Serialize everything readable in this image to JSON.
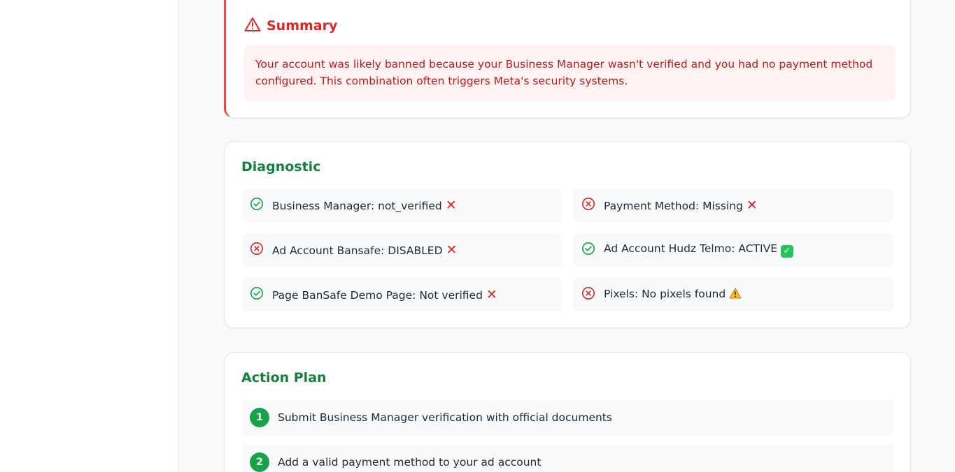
{
  "summary": {
    "title": "Summary",
    "text": "Your account was likely banned because your Business Manager wasn't verified and you had no payment method configured. This combination often triggers Meta's security systems.",
    "icon": "warning-triangle-icon"
  },
  "diagnostic": {
    "title": "Diagnostic",
    "items": [
      {
        "label": "Business Manager: not_verified",
        "status_icon": "check-circle-icon",
        "badge": "cross-mark"
      },
      {
        "label": "Payment Method: Missing",
        "status_icon": "x-circle-icon",
        "badge": "cross-mark"
      },
      {
        "label": "Ad Account Bansafe: DISABLED",
        "status_icon": "x-circle-icon",
        "badge": "cross-mark"
      },
      {
        "label": "Ad Account Hudz Telmo: ACTIVE",
        "status_icon": "check-circle-icon",
        "badge": "check-mark"
      },
      {
        "label": "Page BanSafe Demo Page: Not verified",
        "status_icon": "check-circle-icon",
        "badge": "cross-mark"
      },
      {
        "label": "Pixels: No pixels found",
        "status_icon": "x-circle-icon",
        "badge": "warning"
      }
    ]
  },
  "action_plan": {
    "title": "Action Plan",
    "steps": [
      {
        "number": "1",
        "text": "Submit Business Manager verification with official documents"
      },
      {
        "number": "2",
        "text": "Add a valid payment method to your ad account"
      }
    ]
  },
  "colors": {
    "danger": "#dc2626",
    "success": "#16a34a",
    "title_green": "#15803d",
    "danger_bg": "#fef2f2"
  }
}
